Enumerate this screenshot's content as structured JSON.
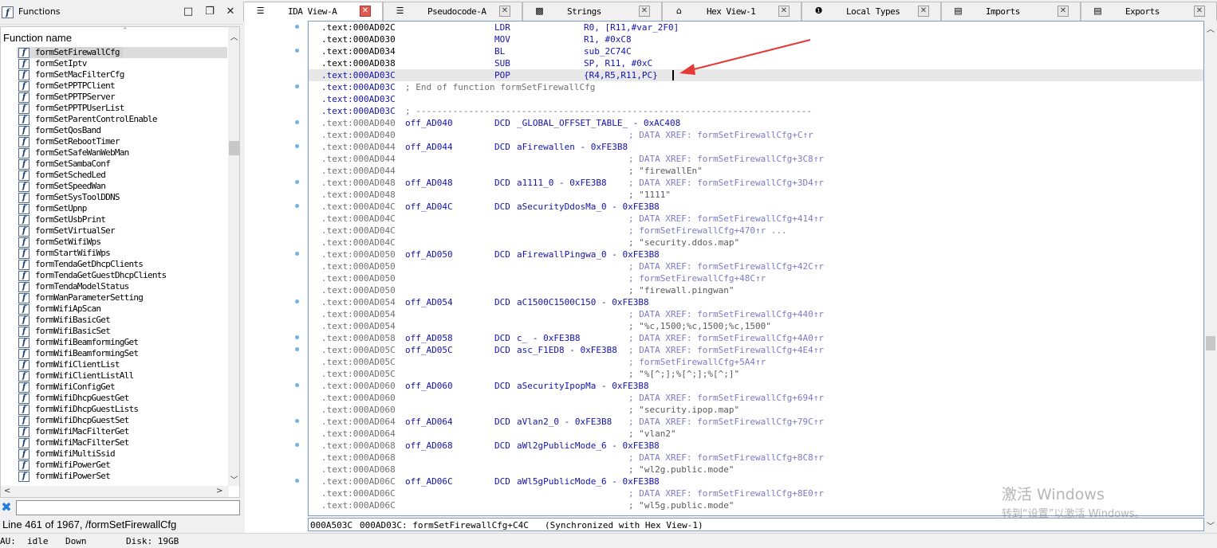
{
  "functions_panel": {
    "title": "Functions",
    "column_header": "Function name",
    "selected_index": 0,
    "items": [
      "formSetFirewallCfg",
      "formSetIptv",
      "formSetMacFilterCfg",
      "formSetPPTPClient",
      "formSetPPTPServer",
      "formSetPPTPUserList",
      "formSetParentControlEnable",
      "formSetQosBand",
      "formSetRebootTimer",
      "formSetSafeWanWebMan",
      "formSetSambaConf",
      "formSetSchedLed",
      "formSetSpeedWan",
      "formSetSysToolDDNS",
      "formSetUpnp",
      "formSetUsbPrint",
      "formSetVirtualSer",
      "formSetWifiWps",
      "formStartWifiWps",
      "formTendaGetDhcpClients",
      "formTendaGetGuestDhcpClients",
      "formTendaModelStatus",
      "formWanParameterSetting",
      "formWifiApScan",
      "formWifiBasicGet",
      "formWifiBasicSet",
      "formWifiBeamformingGet",
      "formWifiBeamformingSet",
      "formWifiClientList",
      "formWifiClientListAll",
      "formWifiConfigGet",
      "formWifiDhcpGuestGet",
      "formWifiDhcpGuestLists",
      "formWifiDhcpGuestSet",
      "formWifiMacFilterGet",
      "formWifiMacFilterSet",
      "formWifiMultiSsid",
      "formWifiPowerGet",
      "formWifiPowerSet"
    ],
    "filter_value": "",
    "status_line": "Line 461 of 1967, /formSetFirewallCfg"
  },
  "statusbar": {
    "au_label": "AU:",
    "au_state": "idle",
    "direction": "Down",
    "disk": "Disk: 19GB"
  },
  "tabs": [
    {
      "label": "IDA View-A",
      "icon": "listing-icon",
      "active": true
    },
    {
      "label": "Pseudocode-A",
      "icon": "pseudocode-icon",
      "active": false
    },
    {
      "label": "Strings",
      "icon": "strings-icon",
      "active": false
    },
    {
      "label": "Hex View-1",
      "icon": "hex-view-icon",
      "active": false
    },
    {
      "label": "Local Types",
      "icon": "local-types-icon",
      "active": false
    },
    {
      "label": "Imports",
      "icon": "imports-icon",
      "active": false
    },
    {
      "label": "Exports",
      "icon": "exports-icon",
      "active": false
    }
  ],
  "listing": {
    "lines": [
      {
        "addr": ".text:000AD02C",
        "label": "",
        "mnem": "LDR",
        "ops": "R0, [R11,#var_2F0]",
        "comment": ""
      },
      {
        "addr": ".text:000AD030",
        "label": "",
        "mnem": "MOV",
        "ops": "R1, #0xC8",
        "comment": ""
      },
      {
        "addr": ".text:000AD034",
        "label": "",
        "mnem": "BL",
        "ops": "sub_2C74C",
        "comment": ""
      },
      {
        "addr": ".text:000AD038",
        "label": "",
        "mnem": "SUB",
        "ops": "SP, R11, #0xC",
        "comment": ""
      },
      {
        "addr": ".text:000AD03C",
        "label": "",
        "mnem": "POP",
        "ops": "{R4,R5,R11,PC}",
        "comment": "",
        "highlight": true
      },
      {
        "addr": ".text:000AD03C",
        "label": "",
        "mnem": "",
        "ops": "",
        "comment": "; End of function formSetFirewallCfg",
        "kind": "endfunc"
      },
      {
        "addr": ".text:000AD03C",
        "label": "",
        "mnem": "",
        "ops": "",
        "comment": "",
        "kind": "blank"
      },
      {
        "addr": ".text:000AD03C",
        "label": "",
        "mnem": "",
        "ops": "",
        "comment": "; ---------------------------------------------------------------------------",
        "kind": "sep"
      },
      {
        "addr": ".text:000AD040",
        "label": "off_AD040",
        "mnem": "DCD",
        "ops": "_GLOBAL_OFFSET_TABLE_ - 0xAC408",
        "comment": ""
      },
      {
        "addr": ".text:000AD040",
        "label": "",
        "mnem": "",
        "ops": "",
        "comment": "; DATA XREF: formSetFirewallCfg+C↑r"
      },
      {
        "addr": ".text:000AD044",
        "label": "off_AD044",
        "mnem": "DCD",
        "ops": "aFirewallen - 0xFE3B8",
        "comment": ""
      },
      {
        "addr": ".text:000AD044",
        "label": "",
        "mnem": "",
        "ops": "",
        "comment": "; DATA XREF: formSetFirewallCfg+3C8↑r"
      },
      {
        "addr": ".text:000AD044",
        "label": "",
        "mnem": "",
        "ops": "",
        "comment": "; \"firewallEn\"",
        "kind": "str"
      },
      {
        "addr": ".text:000AD048",
        "label": "off_AD048",
        "mnem": "DCD",
        "ops": "a1111_0 - 0xFE3B8",
        "comment": "; DATA XREF: formSetFirewallCfg+3D4↑r"
      },
      {
        "addr": ".text:000AD048",
        "label": "",
        "mnem": "",
        "ops": "",
        "comment": "; \"1111\"",
        "kind": "str"
      },
      {
        "addr": ".text:000AD04C",
        "label": "off_AD04C",
        "mnem": "DCD",
        "ops": "aSecurityDdosMa_0 - 0xFE3B8",
        "comment": ""
      },
      {
        "addr": ".text:000AD04C",
        "label": "",
        "mnem": "",
        "ops": "",
        "comment": "; DATA XREF: formSetFirewallCfg+414↑r"
      },
      {
        "addr": ".text:000AD04C",
        "label": "",
        "mnem": "",
        "ops": "",
        "comment": "; formSetFirewallCfg+470↑r ..."
      },
      {
        "addr": ".text:000AD04C",
        "label": "",
        "mnem": "",
        "ops": "",
        "comment": "; \"security.ddos.map\"",
        "kind": "str"
      },
      {
        "addr": ".text:000AD050",
        "label": "off_AD050",
        "mnem": "DCD",
        "ops": "aFirewallPingwa_0 - 0xFE3B8",
        "comment": ""
      },
      {
        "addr": ".text:000AD050",
        "label": "",
        "mnem": "",
        "ops": "",
        "comment": "; DATA XREF: formSetFirewallCfg+42C↑r"
      },
      {
        "addr": ".text:000AD050",
        "label": "",
        "mnem": "",
        "ops": "",
        "comment": "; formSetFirewallCfg+48C↑r"
      },
      {
        "addr": ".text:000AD050",
        "label": "",
        "mnem": "",
        "ops": "",
        "comment": "; \"firewall.pingwan\"",
        "kind": "str"
      },
      {
        "addr": ".text:000AD054",
        "label": "off_AD054",
        "mnem": "DCD",
        "ops": "aC1500C1500C150 - 0xFE3B8",
        "comment": ""
      },
      {
        "addr": ".text:000AD054",
        "label": "",
        "mnem": "",
        "ops": "",
        "comment": "; DATA XREF: formSetFirewallCfg+440↑r"
      },
      {
        "addr": ".text:000AD054",
        "label": "",
        "mnem": "",
        "ops": "",
        "comment": "; \"%c,1500;%c,1500;%c,1500\"",
        "kind": "str"
      },
      {
        "addr": ".text:000AD058",
        "label": "off_AD058",
        "mnem": "DCD",
        "ops": "c_ - 0xFE3B8",
        "comment": "; DATA XREF: formSetFirewallCfg+4A0↑r"
      },
      {
        "addr": ".text:000AD05C",
        "label": "off_AD05C",
        "mnem": "DCD",
        "ops": "asc_F1ED8 - 0xFE3B8",
        "comment": "; DATA XREF: formSetFirewallCfg+4E4↑r"
      },
      {
        "addr": ".text:000AD05C",
        "label": "",
        "mnem": "",
        "ops": "",
        "comment": "; formSetFirewallCfg+5A4↑r"
      },
      {
        "addr": ".text:000AD05C",
        "label": "",
        "mnem": "",
        "ops": "",
        "comment": "; \"%[^;];%[^;];%[^;]\"",
        "kind": "str"
      },
      {
        "addr": ".text:000AD060",
        "label": "off_AD060",
        "mnem": "DCD",
        "ops": "aSecurityIpopMa - 0xFE3B8",
        "comment": ""
      },
      {
        "addr": ".text:000AD060",
        "label": "",
        "mnem": "",
        "ops": "",
        "comment": "; DATA XREF: formSetFirewallCfg+694↑r"
      },
      {
        "addr": ".text:000AD060",
        "label": "",
        "mnem": "",
        "ops": "",
        "comment": "; \"security.ipop.map\"",
        "kind": "str"
      },
      {
        "addr": ".text:000AD064",
        "label": "off_AD064",
        "mnem": "DCD",
        "ops": "aVlan2_0 - 0xFE3B8",
        "comment": "; DATA XREF: formSetFirewallCfg+79C↑r"
      },
      {
        "addr": ".text:000AD064",
        "label": "",
        "mnem": "",
        "ops": "",
        "comment": "; \"vlan2\"",
        "kind": "str"
      },
      {
        "addr": ".text:000AD068",
        "label": "off_AD068",
        "mnem": "DCD",
        "ops": "aWl2gPublicMode_6 - 0xFE3B8",
        "comment": ""
      },
      {
        "addr": ".text:000AD068",
        "label": "",
        "mnem": "",
        "ops": "",
        "comment": "; DATA XREF: formSetFirewallCfg+8C8↑r"
      },
      {
        "addr": ".text:000AD068",
        "label": "",
        "mnem": "",
        "ops": "",
        "comment": "; \"wl2g.public.mode\"",
        "kind": "str"
      },
      {
        "addr": ".text:000AD06C",
        "label": "off_AD06C",
        "mnem": "DCD",
        "ops": "aWl5gPublicMode_6 - 0xFE3B8",
        "comment": ""
      },
      {
        "addr": ".text:000AD06C",
        "label": "",
        "mnem": "",
        "ops": "",
        "comment": "; DATA XREF: formSetFirewallCfg+8E0↑r"
      },
      {
        "addr": ".text:000AD06C",
        "label": "",
        "mnem": "",
        "ops": "",
        "comment": "; \"wl5g.public.mode\"",
        "kind": "str"
      }
    ],
    "status": {
      "file_offset": "000A503C",
      "location": "000AD03C: formSetFirewallCfg+C4C",
      "sync": "(Synchronized with Hex View-1)"
    }
  },
  "watermark": {
    "line1": "激活 Windows",
    "line2": "转到“设置”以激活 Windows。"
  },
  "colors": {
    "listing_blue": "#1313b0",
    "comment_grey": "#707070",
    "xref_purple": "#7a7ac8",
    "highlight_line": "#e8e8e8",
    "annotation_arrow": "#e53935"
  }
}
